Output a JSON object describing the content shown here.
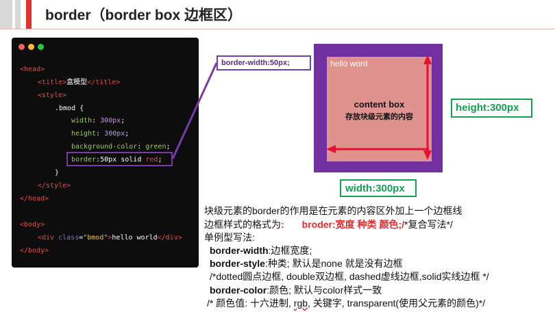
{
  "header": {
    "title": "border（border box 边框区）"
  },
  "code": {
    "lines": {
      "l1": "<head>",
      "l2a": "<title>",
      "l2b": "盒模型",
      "l2c": "</title>",
      "l3": "<style>",
      "l4": ".bmod {",
      "l5a": "width",
      "l5b": ": ",
      "l5c": "300px",
      "l5d": ";",
      "l6a": "height",
      "l6b": ": ",
      "l6c": "300px",
      "l6d": ";",
      "l7a": "background-color",
      "l7b": ": ",
      "l7c": "green",
      "l7d": ";",
      "l8a": "border",
      "l8b": ":50px solid ",
      "l8c": "red",
      "l8d": ";",
      "l9": "}",
      "l10": "</style>",
      "l11": "</head>",
      "l12": "<body>",
      "l13a": "<div ",
      "l13b": "class",
      "l13c": "=",
      "l13d": "\"bmod\"",
      "l13e": ">",
      "l13f": "hello world",
      "l13g": "</div>",
      "l14": "</body>"
    }
  },
  "callout": {
    "label": "border-width:50px;"
  },
  "diagram": {
    "hello": "hello word",
    "content_title": "content box",
    "content_sub": "存放块级元素的内容",
    "height_label": "height:300px",
    "width_label": "width:300px",
    "colors": {
      "border": "#7030a0",
      "content": "#e0928e",
      "arrow": "#e8112d",
      "dim": "#12a152"
    }
  },
  "notes": {
    "line1": "块级元素的border的作用是在元素的内容区外加上一个边框线",
    "line2a": "边框样式的格式为",
    "line2b": ":",
    "line2c": "broder:宽度 种类 颜色;/",
    "line2d": "*复合写法*/",
    "line3": "单例型写法:",
    "line4a": "border-width",
    "line4b": ":边框宽度;",
    "line5a": "border-style",
    "line5b": ":种类;  默认是none 就是没有边框",
    "line6": "/*dotted圆点边框, double双边框, dashed虚线边框,solid实线边框 */",
    "line7a": "border-color",
    "line7b": ":颜色;  默认与color样式一致",
    "line8a": "/* 颜色值: 十六进制, ",
    "line8b": "rgb",
    "line8c": ", 关键字, transparent(使用父元素的颜色)*/"
  }
}
